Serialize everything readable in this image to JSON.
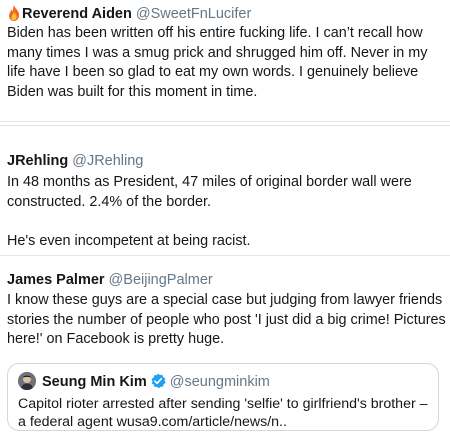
{
  "tweets": [
    {
      "name": "Reverend Aiden",
      "handle": "@SweetFnLucifer",
      "name_icon": "fire-emoji-icon",
      "text": "Biden has been written off his entire fucking life. I can’t recall how many times I was a smug prick and shrugged him off. Never in my life have I been so glad to eat my own words. I genuinely believe Biden was built for this moment in time."
    },
    {
      "name": "JRehling",
      "handle": "@JRehling",
      "text": "In 48 months as President, 47 miles of original border wall were constructed. 2.4% of the border.\n\nHe's even incompetent at being racist."
    },
    {
      "name": "James Palmer",
      "handle": "@BeijingPalmer",
      "text": "I know these guys are a special case but judging from lawyer friends stories the number of people who post 'I just did a big crime! Pictures here!' on Facebook is pretty huge.",
      "quote": {
        "name": "Seung Min Kim",
        "handle": "@seungminkim",
        "verified_icon": "verified-badge-icon",
        "text": "Capitol rioter arrested after sending 'selfie' to girlfriend's brother – a federal agent wusa9.com/article/news/n.."
      }
    }
  ],
  "colors": {
    "text": "#14171a",
    "handle": "#657786",
    "separator": "#e1e8ed",
    "verified": "#1da1f2"
  }
}
